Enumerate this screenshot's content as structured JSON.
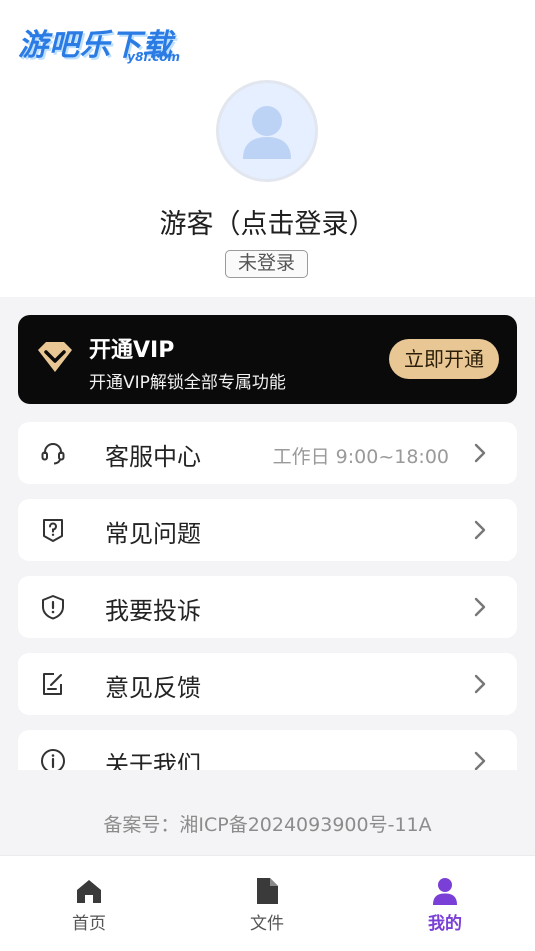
{
  "brand": {
    "logo_text": "游吧乐下载",
    "logo_sub": "y8l.com",
    "primary_color": "#2b7be4",
    "accent_color": "#7a3fd6"
  },
  "profile": {
    "username": "游客（点击登录）",
    "status_badge": "未登录",
    "avatar_icon": "user-avatar-icon"
  },
  "vip_banner": {
    "title": "开通VIP",
    "subtitle": "开通VIP解锁全部专属功能",
    "button_label": "立即开通",
    "icon": "diamond-icon"
  },
  "menu": [
    {
      "label": "客服中心",
      "hint": "工作日 9:00~18:00",
      "icon": "headset-icon"
    },
    {
      "label": "常见问题",
      "hint": "",
      "icon": "question-icon"
    },
    {
      "label": "我要投诉",
      "hint": "",
      "icon": "alert-icon"
    },
    {
      "label": "意见反馈",
      "hint": "",
      "icon": "feedback-edit-icon"
    },
    {
      "label": "关于我们",
      "hint": "",
      "icon": "info-icon"
    }
  ],
  "footer": {
    "icp": "备案号：湘ICP备2024093900号-11A"
  },
  "tabbar": [
    {
      "label": "首页",
      "icon": "home-icon",
      "active": false
    },
    {
      "label": "文件",
      "icon": "file-icon",
      "active": false
    },
    {
      "label": "我的",
      "icon": "profile-icon",
      "active": true
    }
  ]
}
